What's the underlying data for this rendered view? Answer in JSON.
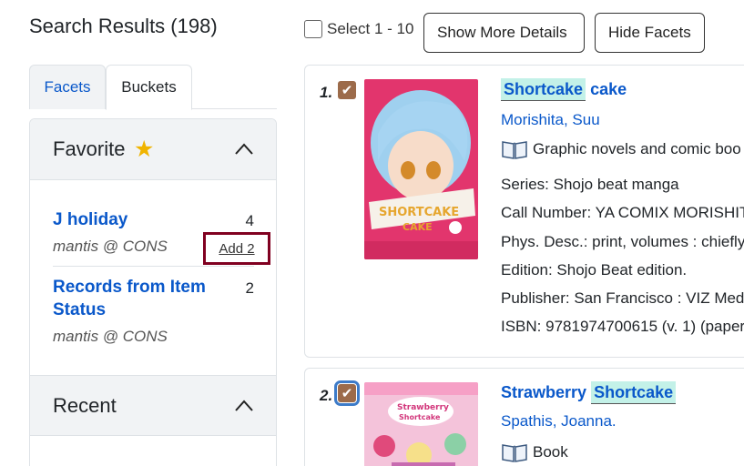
{
  "header": {
    "title": "Search Results (198)"
  },
  "toolbar": {
    "select_label": "Select 1 - 10",
    "show_more_label": "Show More Details",
    "hide_facets_label": "Hide Facets"
  },
  "tabs": [
    {
      "label": "Facets",
      "active": false
    },
    {
      "label": "Buckets",
      "active": true
    }
  ],
  "favorite": {
    "heading": "Favorite",
    "star_icon": "star-icon",
    "buckets": [
      {
        "name": "J holiday",
        "count": "4",
        "owner": "mantis @ CONS",
        "add_label": "Add 2"
      },
      {
        "name_line1": "Records from Item",
        "name_line2": "Status",
        "count": "2",
        "owner": "mantis @ CONS"
      }
    ]
  },
  "recent": {
    "heading": "Recent"
  },
  "results": [
    {
      "number": "1.",
      "checked": true,
      "title_hl": "Shortcake",
      "title_rest": "cake",
      "author": "Morishita, Suu",
      "format": "Graphic novels and comic boo",
      "series": "Series: Shojo beat manga",
      "call_number": "Call Number: YA COMIX MORISHIT",
      "phys_desc": "Phys. Desc.: print, volumes : chiefly",
      "edition": "Edition: Shojo Beat edition.",
      "publisher": "Publisher: San Francisco : VIZ Medi",
      "isbn": "ISBN: 9781974700615 (v. 1) (paper"
    },
    {
      "number": "2.",
      "checked": true,
      "title_pre": "Strawberry",
      "title_hl": "Shortcake",
      "author": "Spathis, Joanna.",
      "format": "Book"
    }
  ],
  "colors": {
    "link": "#0a58ca",
    "highlight": "#c3f1e8",
    "checkbox": "#9c6b4a",
    "add_outline": "#800020",
    "focus": "#3d7bc8"
  }
}
